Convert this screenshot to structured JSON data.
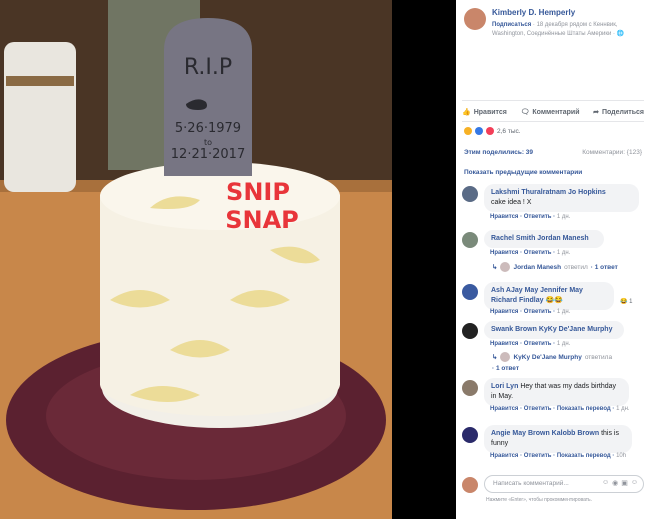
{
  "photo": {
    "tombstone_line1": "R.I.P",
    "tombstone_line2": "5·26·1979",
    "tombstone_line3": "to",
    "tombstone_line4": "12·21·2017",
    "cake_text_1": "SNIP",
    "cake_text_2": "SNAP"
  },
  "post": {
    "author": "Kimberly D. Hemperly",
    "subscribe": "Подписаться",
    "meta": "· 18 декабря рядом с Кеннвик, Washington, Соединённые Штаты Америки · ",
    "globe_icon": "globe-icon"
  },
  "actions": {
    "like": "Нравится",
    "comment": "Комментарий",
    "share": "Поделиться"
  },
  "reactions": {
    "count": "2,6 тыс."
  },
  "stats": {
    "shares": "Этим поделились: 39",
    "comments": "Комментарии: {123}"
  },
  "prev_comments": "Показать предыдущие комментарии",
  "comments": [
    {
      "author": "Lakshmi Thuralratnam Jo Hopkins",
      "text": "cake idea ! X",
      "like": "Нравится",
      "reply": "Ответить",
      "time": "1 дн."
    },
    {
      "author": "Rachel Smith Jordan Manesh",
      "text": "",
      "like": "Нравится",
      "reply": "Ответить",
      "time": "1 дн.",
      "reply_line": {
        "name": "Jordan Manesh",
        "action": "ответил",
        "count": "· 1 ответ"
      }
    },
    {
      "author": "Ash AJay May Jennifer May Richard Findlay",
      "text": "😂😂",
      "like": "Нравится",
      "reply": "Ответить",
      "time": "1 дн.",
      "likes": "1"
    },
    {
      "author": "Swank Brown KyKy De'Jane Murphy",
      "text": "",
      "like": "Нравится",
      "reply": "Ответить",
      "time": "1 дн.",
      "reply_line": {
        "name": "KyKy De'Jane Murphy",
        "action": "ответила",
        "count": "· 1 ответ"
      }
    },
    {
      "author": "Lori Lyn",
      "text": "Hey that was my dads birthday in May.",
      "like": "Нравится",
      "reply": "Ответить",
      "translate": "Показать перевод",
      "time": "1 дн."
    },
    {
      "author": "Angie May Brown Kalobb Brown",
      "text": "this is funny",
      "like": "Нравится",
      "reply": "Ответить",
      "translate": "Показать перевод",
      "time": "10h"
    }
  ],
  "write": {
    "placeholder": "Написать комментарий...",
    "hint": "Нажмите «Enter», чтобы прокомментировать."
  },
  "colors": {
    "link": "#365899",
    "muted": "#90949c",
    "frosting": "#f7f0dc",
    "icing_red": "#e8353a"
  }
}
